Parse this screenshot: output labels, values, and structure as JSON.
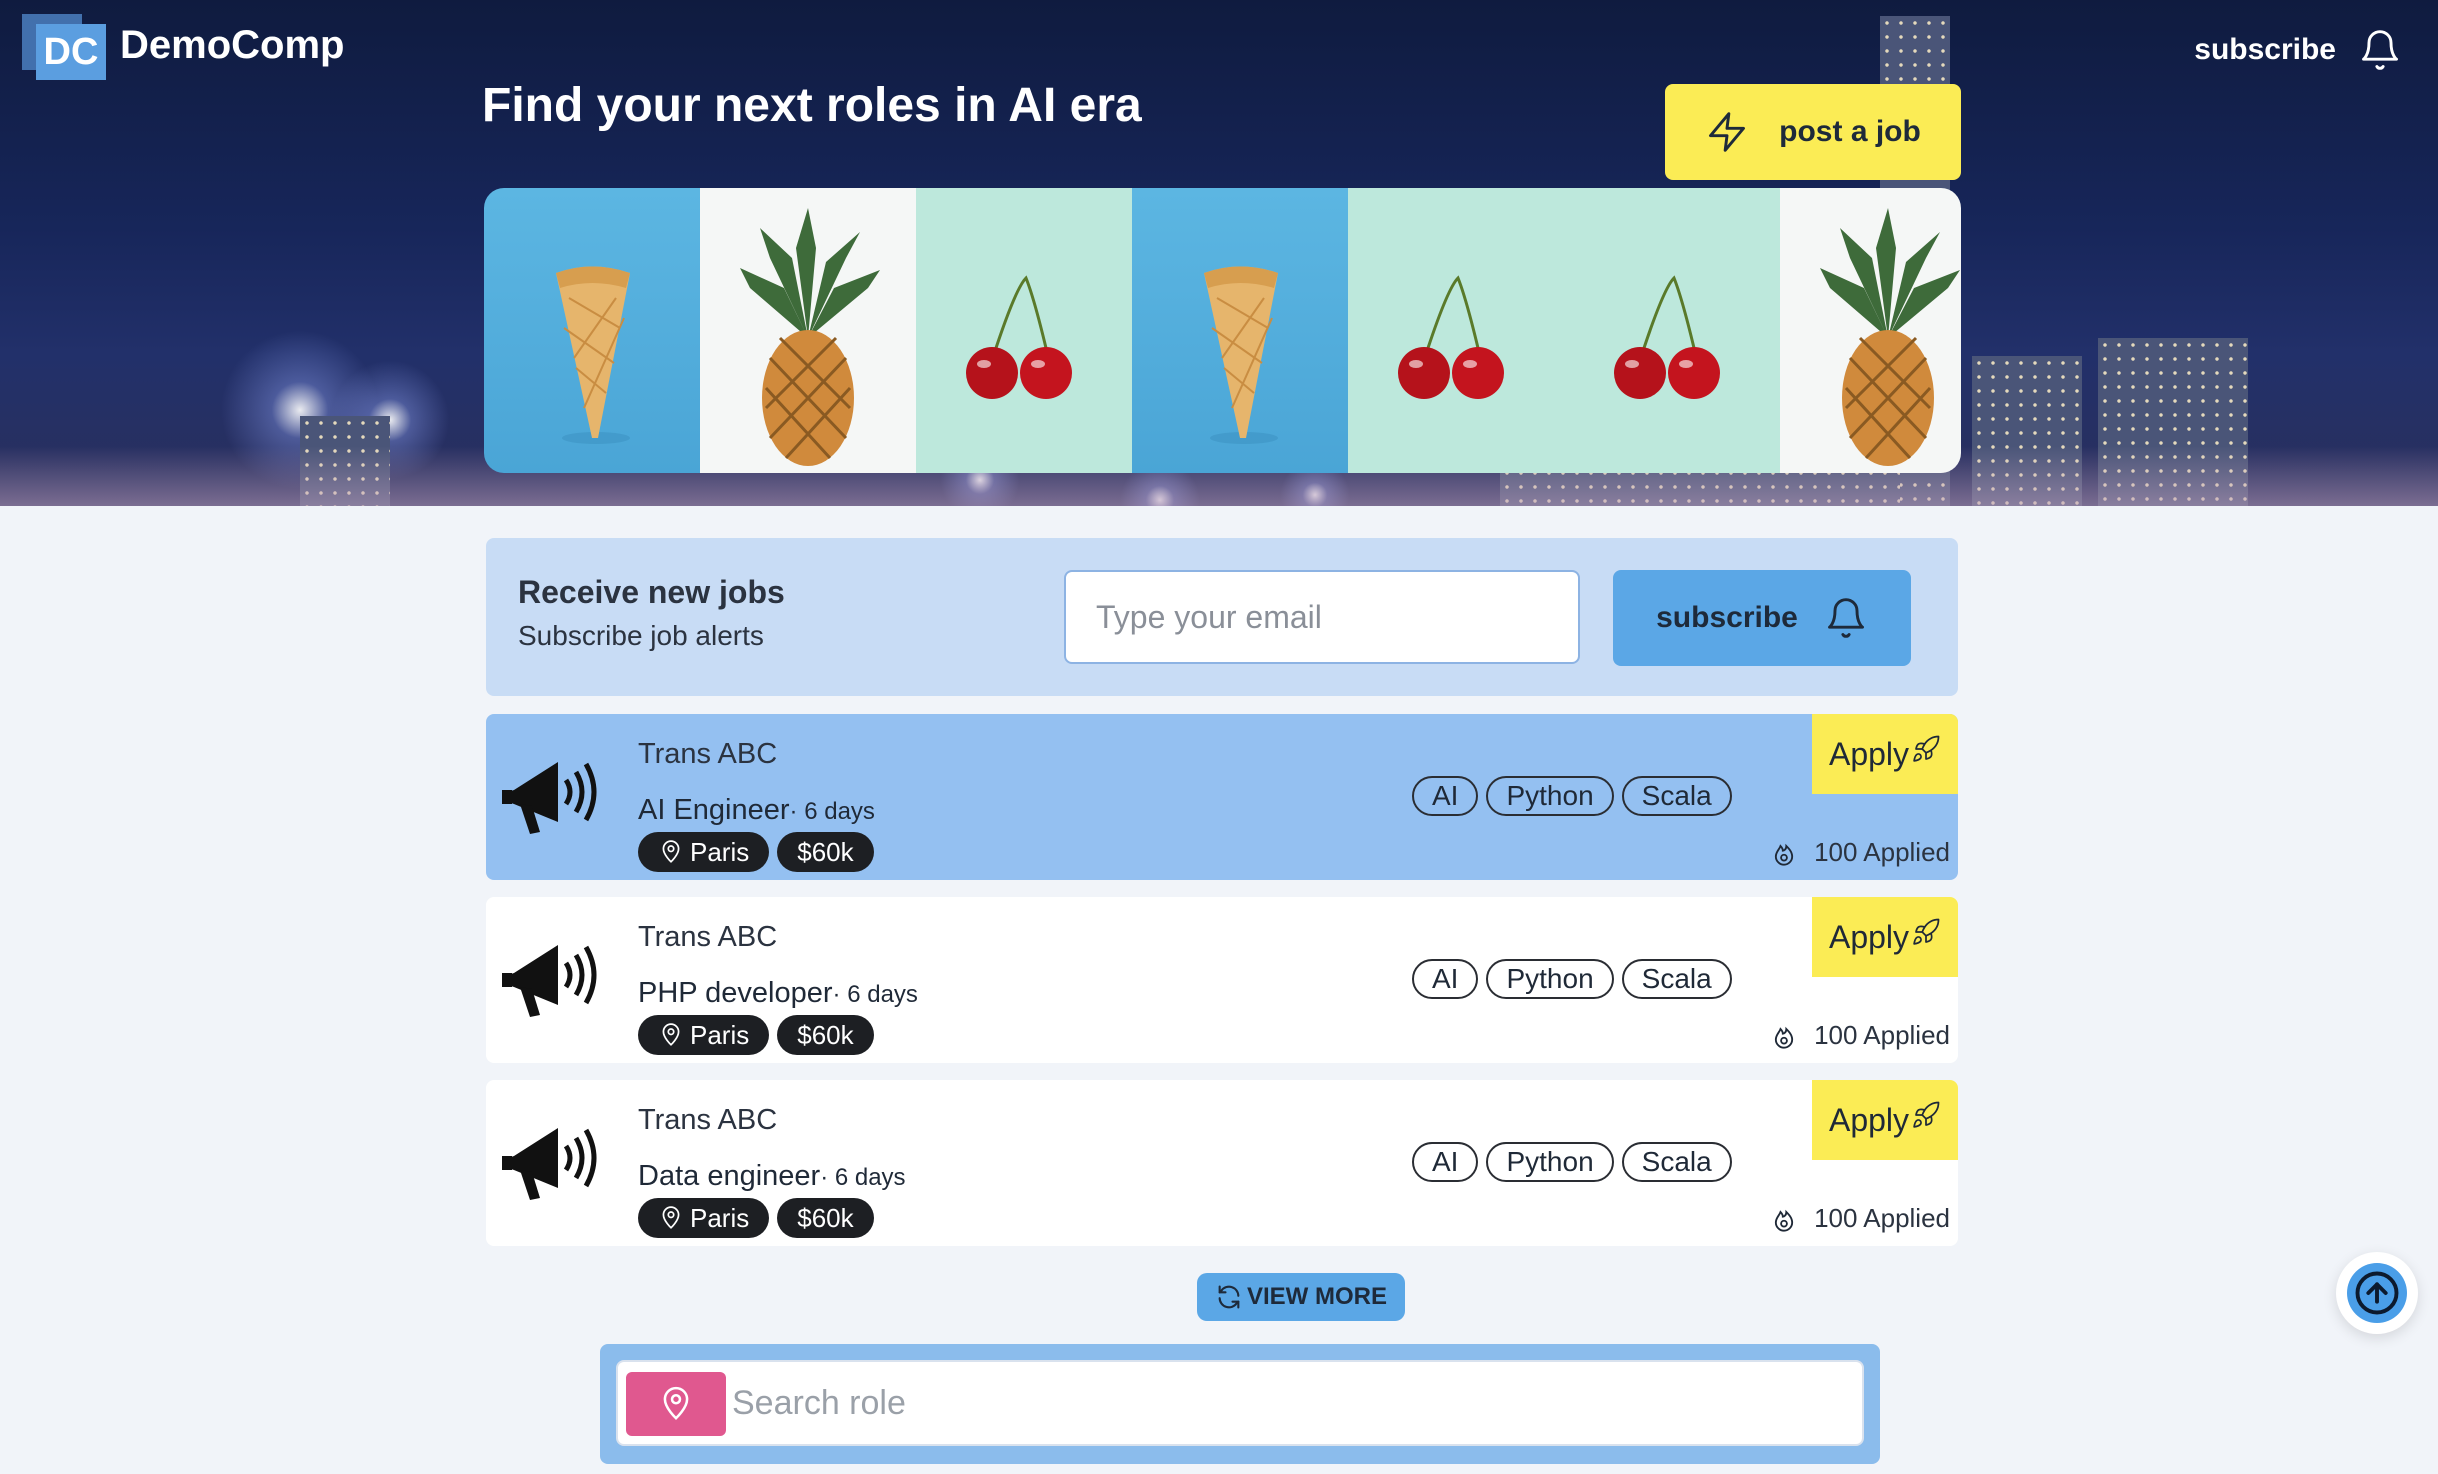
{
  "brand": {
    "logo_mark": "DC",
    "name": "DemoComp"
  },
  "header": {
    "subscribe_label": "subscribe",
    "bell_icon": "bell-icon"
  },
  "hero": {
    "title": "Find your next roles in AI era",
    "post_job_label": "post a job",
    "post_job_icon": "lightning-icon",
    "gallery": [
      "ice-cream-cone",
      "pineapple",
      "cherries",
      "ice-cream-cone",
      "cherries",
      "cherries",
      "pineapple"
    ]
  },
  "alert": {
    "title": "Receive new jobs",
    "subtitle": "Subscribe job alerts",
    "email_placeholder": "Type your email",
    "subscribe_label": "subscribe"
  },
  "jobs": [
    {
      "company": "Trans ABC",
      "role": "AI Engineer",
      "age": "· 6 days",
      "location": "Paris",
      "salary": "$60k",
      "tags": [
        "AI",
        "Python",
        "Scala"
      ],
      "apply_label": "Apply",
      "applied": "100 Applied",
      "highlighted": true
    },
    {
      "company": "Trans ABC",
      "role": "PHP developer",
      "age": "· 6 days",
      "location": "Paris",
      "salary": "$60k",
      "tags": [
        "AI",
        "Python",
        "Scala"
      ],
      "apply_label": "Apply",
      "applied": "100 Applied",
      "highlighted": false
    },
    {
      "company": "Trans ABC",
      "role": "Data engineer",
      "age": "· 6 days",
      "location": "Paris",
      "salary": "$60k",
      "tags": [
        "AI",
        "Python",
        "Scala"
      ],
      "apply_label": "Apply",
      "applied": "100 Applied",
      "highlighted": false
    }
  ],
  "view_more_label": "VIEW MORE",
  "search": {
    "placeholder": "Search role"
  },
  "colors": {
    "accent_yellow": "#fbec55",
    "accent_blue": "#5ba7e6",
    "highlight_card": "#94c0f1",
    "search_pin": "#e0588f"
  }
}
